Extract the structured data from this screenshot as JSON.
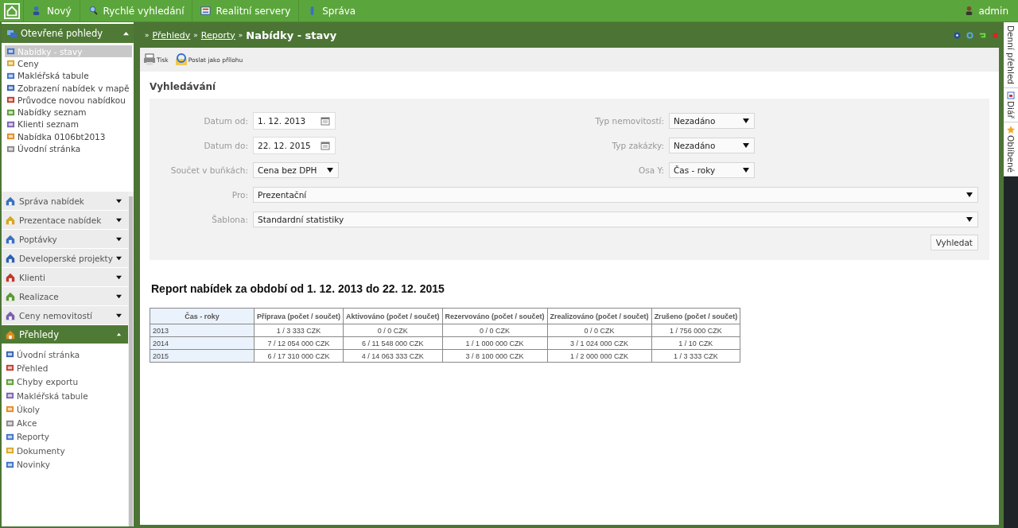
{
  "top_menu": [
    "Nový",
    "Rychlé vyhledání",
    "Realitní servery",
    "Správa"
  ],
  "user": "admin",
  "sidebar": {
    "open_views": {
      "title": "Otevřené pohledy",
      "expanded": true,
      "items": [
        {
          "label": "Nabídky - stavy",
          "selected": true
        },
        {
          "label": "Ceny",
          "selected": false
        },
        {
          "label": "Makléřská tabule",
          "selected": false
        },
        {
          "label": "Zobrazení nabídek v mapě",
          "selected": false
        },
        {
          "label": "Průvodce novou nabídkou",
          "selected": false
        },
        {
          "label": "Nabídky seznam",
          "selected": false
        },
        {
          "label": "Klienti seznam",
          "selected": false
        },
        {
          "label": "Nabídka 0106bt2013",
          "selected": false
        },
        {
          "label": "Úvodní stránka",
          "selected": false
        }
      ]
    },
    "sections": [
      {
        "title": "Správa nabídek",
        "expanded": false
      },
      {
        "title": "Prezentace nabídek",
        "expanded": false
      },
      {
        "title": "Poptávky",
        "expanded": false
      },
      {
        "title": "Developerské projekty",
        "expanded": false
      },
      {
        "title": "Klienti",
        "expanded": false
      },
      {
        "title": "Realizace",
        "expanded": false
      },
      {
        "title": "Ceny nemovitostí",
        "expanded": false
      },
      {
        "title": "Přehledy",
        "expanded": true,
        "items": [
          "Úvodní stránka",
          "Přehled",
          "Chyby exportu",
          "Makléřská tabule",
          "Úkoly",
          "Akce",
          "Reporty",
          "Dokumenty",
          "Novinky"
        ]
      }
    ]
  },
  "breadcrumb": {
    "separator": "»",
    "links": [
      "Přehledy",
      "Reporty"
    ],
    "current": "Nabídky - stavy"
  },
  "toolbar": [
    "Tisk",
    "Poslat jako přílohu"
  ],
  "search": {
    "title": "Vyhledávání",
    "left_fields": [
      {
        "label": "Datum od:",
        "value": "1. 12. 2013",
        "kind": "date"
      },
      {
        "label": "Datum do:",
        "value": "22. 12. 2015",
        "kind": "date"
      },
      {
        "label": "Součet v buňkách:",
        "value": "Cena bez DPH",
        "kind": "select"
      }
    ],
    "right_fields": [
      {
        "label": "Typ nemovitostí:",
        "value": "Nezadáno"
      },
      {
        "label": "Typ zakázky:",
        "value": "Nezadáno"
      },
      {
        "label": "Osa Y:",
        "value": "Čas - roky"
      }
    ],
    "wide_fields": [
      {
        "label": "Pro:",
        "value": "Prezentační"
      },
      {
        "label": "Šablona:",
        "value": "Standardní statistiky"
      }
    ],
    "button": "Vyhledat"
  },
  "report": {
    "title": "Report nabídek za období od 1. 12. 2013 do 22. 12. 2015",
    "columns": [
      "Čas - roky",
      "Příprava (počet / součet)",
      "Aktivováno (počet / součet)",
      "Rezervováno (počet / součet)",
      "Zrealizováno (počet / součet)",
      "Zrušeno (počet / součet)"
    ],
    "rows": [
      [
        "2013",
        "1 / 3 333 CZK",
        "0 / 0 CZK",
        "0 / 0 CZK",
        "0 / 0 CZK",
        "1 / 756 000 CZK"
      ],
      [
        "2014",
        "7 / 12 054 000 CZK",
        "6 / 11 548 000 CZK",
        "1 / 1 000 000 CZK",
        "3 / 1 024 000 CZK",
        "1 / 10 CZK"
      ],
      [
        "2015",
        "6 / 17 310 000 CZK",
        "4 / 14 063 333 CZK",
        "3 / 8 100 000 CZK",
        "1 / 2 000 000 CZK",
        "1 / 3 333 CZK"
      ]
    ]
  },
  "side_tabs": [
    "Denní přehled",
    "Diář",
    "Oblíbené"
  ]
}
